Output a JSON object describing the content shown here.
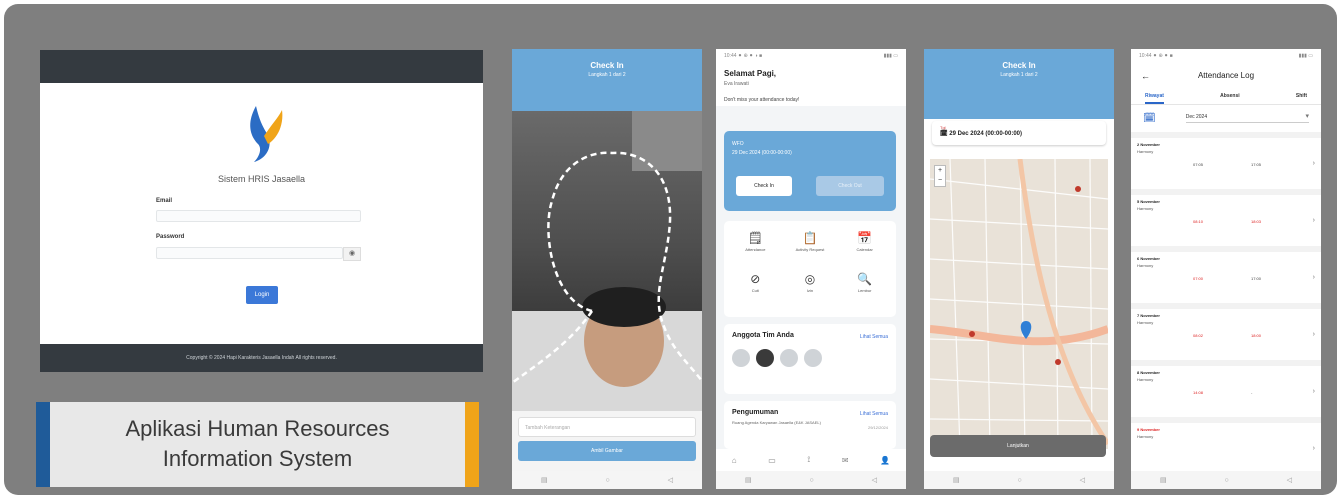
{
  "caption": {
    "line1": "Aplikasi Human Resources",
    "line2": "Information System"
  },
  "colors": {
    "frame": "#7f7f7f",
    "primary_blue": "#6aa8d8",
    "caption_left": "#1f5b99",
    "caption_right": "#f0a419"
  },
  "web_login": {
    "app_name": "Sistem HRIS Jasaella",
    "email_label": "Email",
    "password_label": "Password",
    "eye_icon": "eye-icon",
    "login_label": "Login",
    "footer": "Copyright © 2024 Hapi Karakteris Jasaella Indah All rights reserved."
  },
  "phone_camera": {
    "status_time": "10:45 ⚫ ⚫ ■",
    "title": "Check In",
    "subtitle": "Langkah 1 dari 2",
    "keterangan_placeholder": "Tambah Keterangan",
    "submit_label": "Ambil Gambar",
    "nav": [
      "▤",
      "○",
      "◁"
    ]
  },
  "phone_dashboard": {
    "status_time": "10:44 ⚫ ⊕ ⚫ ◑ ■",
    "greeting": "Selamat Pagi,",
    "user": "Eva Irawati",
    "subtext": "Don't miss your attendance today!",
    "card_tag": "WFO",
    "card_date": "29 Dec 2024 (00:00-00:00)",
    "checkin_label": "Check In",
    "checkout_label": "Check Out",
    "menu": [
      {
        "icon": "🗒",
        "label": "Attendance"
      },
      {
        "icon": "📋",
        "label": "Activity Request"
      },
      {
        "icon": "📅",
        "label": "Calendar"
      },
      {
        "icon": "⊘",
        "label": "Cuti"
      },
      {
        "icon": "◎",
        "label": "Izin"
      },
      {
        "icon": "🔍",
        "label": "Lembur"
      }
    ],
    "team_title": "Anggota Tim Anda",
    "see_all": "Lihat Semua",
    "news_title": "Pengumuman",
    "news_body": "Ruang Agenda Karyawan Jasaella (E&K JASAEL)",
    "news_date": "29/12/2024",
    "bottom_nav": [
      "⌂",
      "▭",
      "⟟",
      "✉",
      "👤"
    ],
    "nav": [
      "▤",
      "○",
      "◁"
    ]
  },
  "phone_map": {
    "status_time": "10:45 ⚫ ⊕ ■",
    "title": "Check In",
    "subtitle": "Langkah 1 dari 2",
    "date_key": "Tgl",
    "date_value": "29 Dec 2024 (00:00-00:00)",
    "continue_label": "Lanjutkan",
    "nav": [
      "▤",
      "○",
      "◁"
    ]
  },
  "phone_log": {
    "status_time": "10:44 ⚫ ⊕ ⚫ ■",
    "title": "Attendance Log",
    "tabs": [
      "Riwayat",
      "Absensi",
      "Shift"
    ],
    "month": "Dec 2024",
    "rows": [
      {
        "date": "2 November",
        "shift": "Harmony",
        "in": "07:05",
        "out": "17:05",
        "in_red": false,
        "out_red": false,
        "date_red": false
      },
      {
        "date": "5 November",
        "shift": "Harmony",
        "in": "08:10",
        "out": "18:03",
        "in_red": true,
        "out_red": true,
        "date_red": false
      },
      {
        "date": "6 November",
        "shift": "Harmony",
        "in": "07:00",
        "out": "17:00",
        "in_red": true,
        "out_red": false,
        "date_red": false
      },
      {
        "date": "7 November",
        "shift": "Harmony",
        "in": "08:02",
        "out": "18:00",
        "in_red": true,
        "out_red": true,
        "date_red": false
      },
      {
        "date": "8 November",
        "shift": "Harmony",
        "in": "14:08",
        "out": "-",
        "in_red": true,
        "out_red": false,
        "date_red": false
      },
      {
        "date": "9 November",
        "shift": "Harmony",
        "in": "",
        "out": "",
        "in_red": false,
        "out_red": false,
        "date_red": true
      }
    ],
    "nav": [
      "▤",
      "○",
      "◁"
    ]
  }
}
